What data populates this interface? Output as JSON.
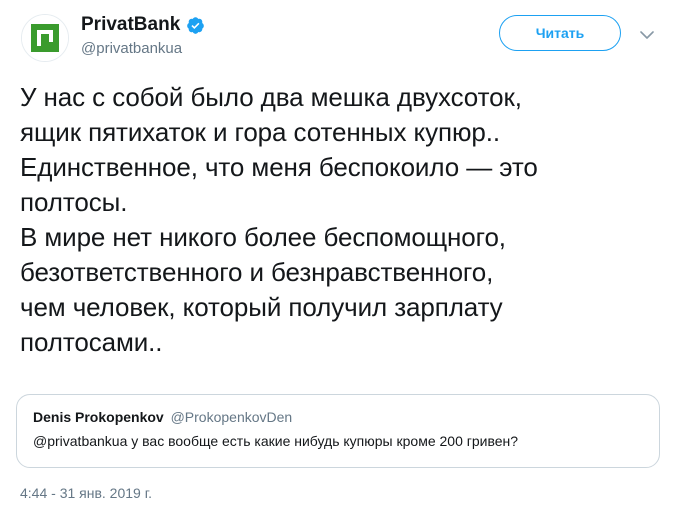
{
  "author": {
    "display_name": "PrivatBank",
    "handle": "@privatbankua",
    "avatar_icon": "privatbank-logo-icon",
    "verified_icon": "verified-badge-icon",
    "brand_color": "#3a9b2d"
  },
  "actions": {
    "follow_label": "Читать",
    "more_icon": "chevron-down-icon"
  },
  "tweet": {
    "lines": [
      "У нас с собой было два мешка двухсоток,",
      "ящик пятихаток и гора сотенных купюр..",
      "Единственное, что меня беспокоило — это",
      "полтосы.",
      "В мире нет никого более беспомощного,",
      "безответственного и безнравственного,",
      "чем человек, который получил зарплату",
      "полтосами.."
    ]
  },
  "quoted_tweet": {
    "display_name": "Denis Prokopenkov",
    "handle": "@ProkopenkovDen",
    "text": "@privatbankua у вас вообще есть какие нибудь купюры кроме 200 гривен?"
  },
  "timestamp": "4:44 - 31 янв. 2019 г.",
  "colors": {
    "accent": "#1da1f2",
    "secondary_text": "#657786",
    "border": "#ccd6dd"
  }
}
